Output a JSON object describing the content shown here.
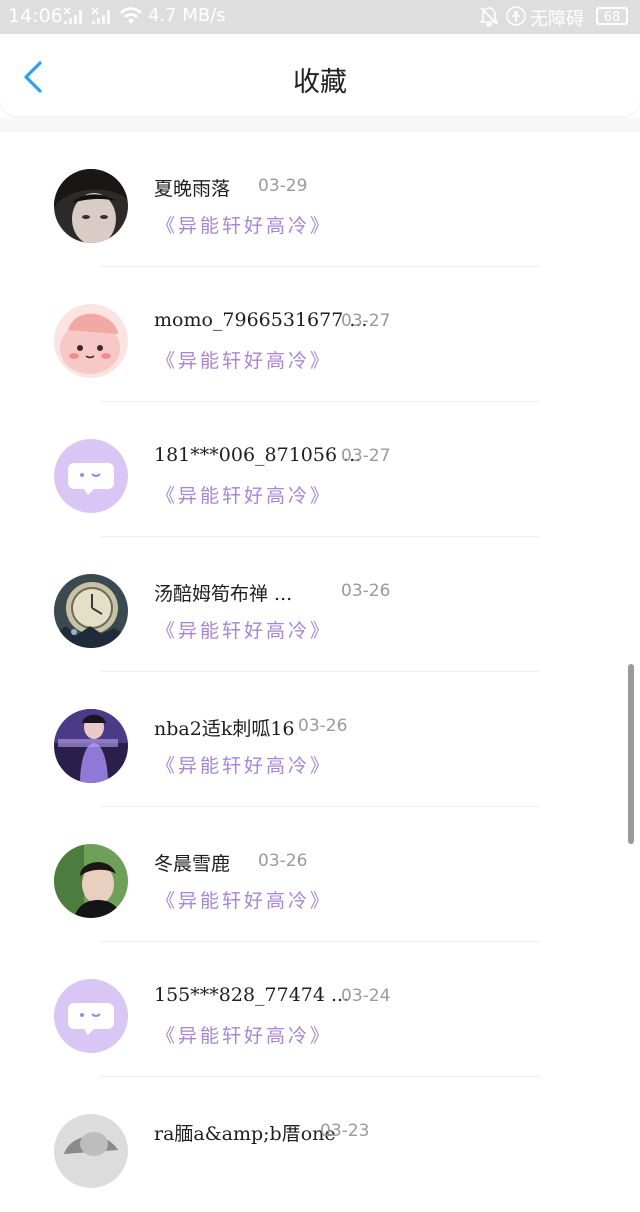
{
  "status_bar": {
    "time": "14:06",
    "network_speed": "4.7 MB/s",
    "accessibility": "无障碍",
    "battery": "68"
  },
  "header": {
    "title": "收藏"
  },
  "items": [
    {
      "name": "夏晚雨落",
      "date": "03-29",
      "book": "《异能轩好高冷》",
      "avatar": "photo-boy-avatar"
    },
    {
      "name": "momo_7966531677 ...",
      "date": "03-27",
      "book": "《异能轩好高冷》",
      "avatar": "pink-cartoon-avatar"
    },
    {
      "name": "181***006_871056 ...",
      "date": "03-27",
      "book": "《异能轩好高冷》",
      "avatar": "default-chat-avatar"
    },
    {
      "name": "汤醅姆筍布禅 ...",
      "date": "03-26",
      "book": "《异能轩好高冷》",
      "avatar": "clock-avatar"
    },
    {
      "name": "nba2适k刺呱16",
      "date": "03-26",
      "book": "《异能轩好高冷》",
      "avatar": "purple-photo-avatar"
    },
    {
      "name": "冬晨雪鹿",
      "date": "03-26",
      "book": "《异能轩好高冷》",
      "avatar": "photo-man-avatar"
    },
    {
      "name": "155***828_77474 ...",
      "date": "03-24",
      "book": "《异能轩好高冷》",
      "avatar": "default-chat-avatar"
    },
    {
      "name": "ra腼a&amp;b厝one",
      "date": "03-23",
      "book": "",
      "avatar": "photo-avatar"
    }
  ],
  "colors": {
    "accent": "#2f9ff0",
    "book_title": "#a885d8",
    "default_avatar": "#d9c6f5"
  }
}
